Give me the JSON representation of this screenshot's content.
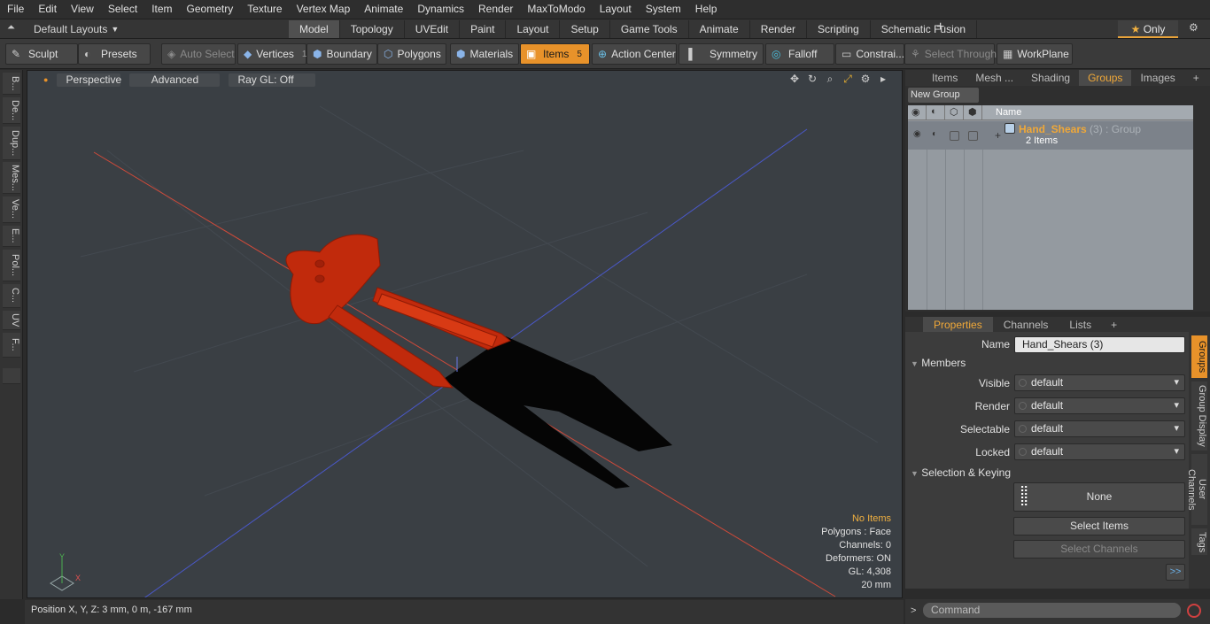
{
  "menu": [
    "File",
    "Edit",
    "View",
    "Select",
    "Item",
    "Geometry",
    "Texture",
    "Vertex Map",
    "Animate",
    "Dynamics",
    "Render",
    "MaxToModo",
    "Layout",
    "System",
    "Help"
  ],
  "layout_select": "Default Layouts",
  "mode_tabs": [
    "Model",
    "Topology",
    "UVEdit",
    "Paint",
    "Layout",
    "Setup",
    "Game Tools",
    "Animate",
    "Render",
    "Scripting",
    "Schematic Fusion"
  ],
  "mode_active": "Model",
  "only_label": "Only",
  "tools": {
    "sculpt": "Sculpt",
    "presets": "Presets",
    "auto_select": "Auto Select",
    "vertices": "Vertices",
    "vertices_count": "1",
    "boundary": "Boundary",
    "polygons": "Polygons",
    "materials": "Materials",
    "items": "Items",
    "items_count": "5",
    "action_center": "Action Center",
    "symmetry": "Symmetry",
    "falloff": "Falloff",
    "constraints": "Constrai...",
    "select_through": "Select Through",
    "workplane": "WorkPlane"
  },
  "left_tabs": [
    "B...",
    "De...",
    "Dup...",
    "Mes...",
    "Ve...",
    "E...",
    "Pol...",
    "C...",
    "UV",
    "F..."
  ],
  "viewport": {
    "perspective": "Perspective",
    "advanced": "Advanced",
    "raygl": "Ray GL: Off",
    "info": {
      "items": "No Items",
      "polygons": "Polygons : Face",
      "channels": "Channels: 0",
      "deformers": "Deformers: ON",
      "gl": "GL: 4,308",
      "scale": "20 mm"
    }
  },
  "status": "Position X, Y, Z:  3 mm, 0 m, -167 mm",
  "right_tabs": [
    "Items",
    "Mesh ...",
    "Shading",
    "Groups",
    "Images"
  ],
  "right_tab_active": "Groups",
  "new_group": "New Group",
  "group_list": {
    "name_header": "Name",
    "group_name": "Hand_Shears",
    "group_meta": "(3) : Group",
    "group_items": "2 Items"
  },
  "props_tabs": [
    "Properties",
    "Channels",
    "Lists"
  ],
  "props_tab_active": "Properties",
  "side_tabs": [
    "Groups",
    "Group Display",
    "User Channels",
    "Tags"
  ],
  "properties": {
    "name_label": "Name",
    "name_value": "Hand_Shears (3)",
    "members_section": "Members",
    "visible_label": "Visible",
    "visible_value": "default",
    "render_label": "Render",
    "render_value": "default",
    "selectable_label": "Selectable",
    "selectable_value": "default",
    "locked_label": "Locked",
    "locked_value": "default",
    "selection_section": "Selection & Keying",
    "none_label": "None",
    "select_items": "Select Items",
    "select_channels": "Select Channels",
    "more": ">>"
  },
  "command_placeholder": "Command",
  "colors": {
    "accent": "#e8922a",
    "group_name": "#f0a838",
    "shears_red": "#c8280a"
  }
}
